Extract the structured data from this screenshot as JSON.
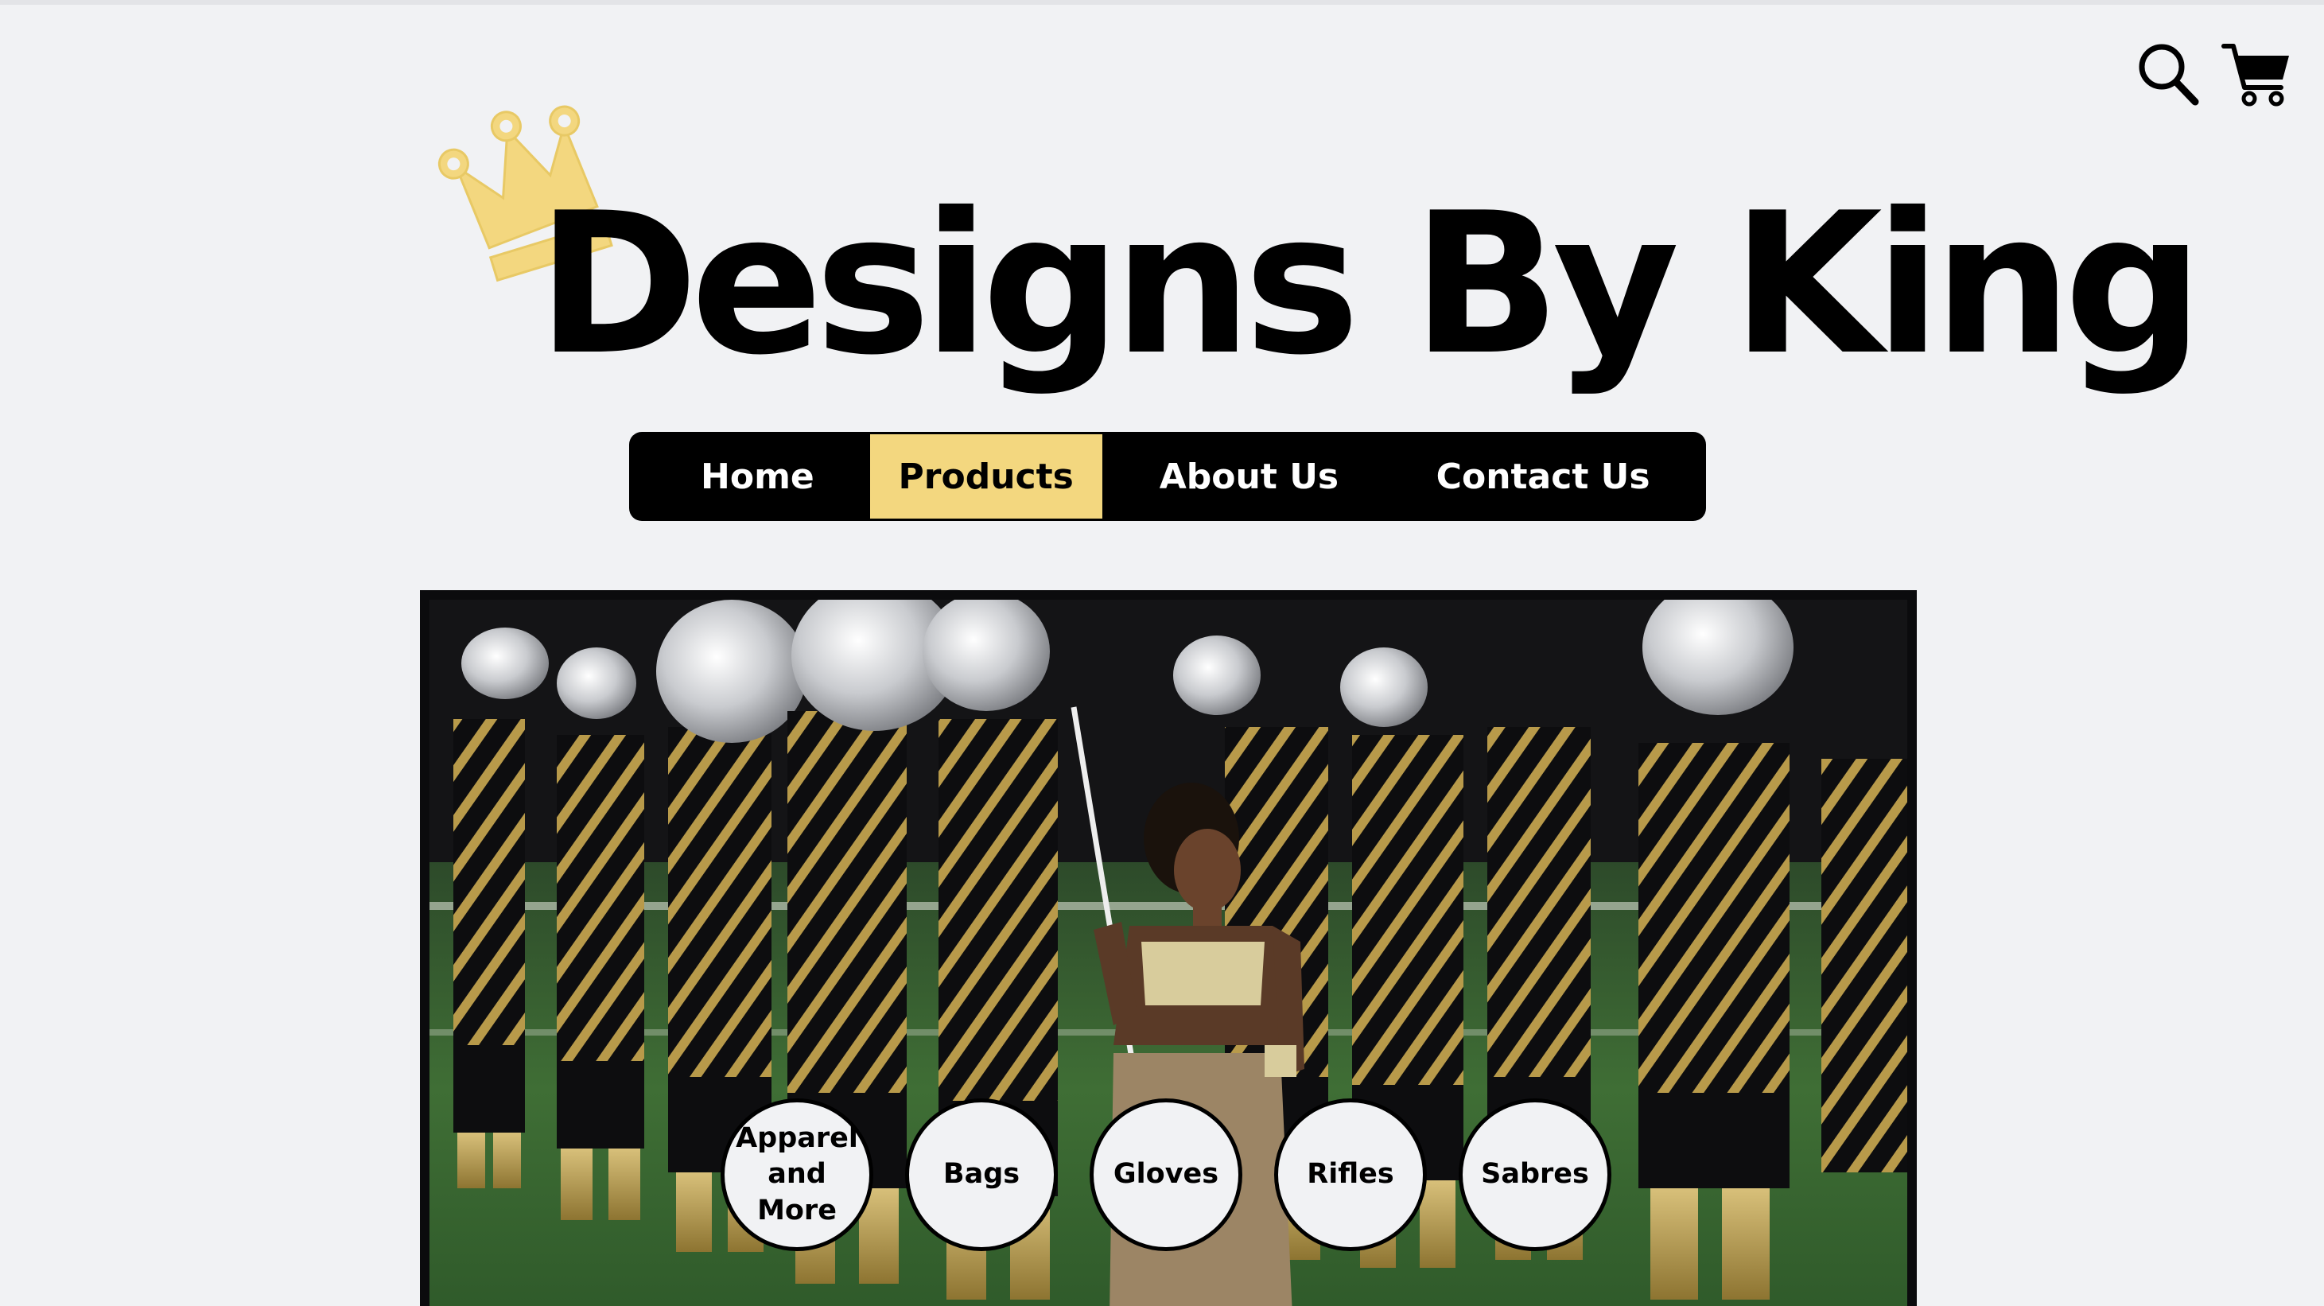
{
  "header": {
    "search_icon": "search-icon",
    "cart_icon": "cart-icon"
  },
  "brand": {
    "title": "Designs By King",
    "logo_icon": "crown-icon",
    "accent_color": "#f3d77f"
  },
  "nav": {
    "items": [
      {
        "label": "Home",
        "active": false
      },
      {
        "label": "Products",
        "active": true
      },
      {
        "label": "About Us",
        "active": false
      },
      {
        "label": "Contact Us",
        "active": false
      }
    ]
  },
  "hero": {
    "image_subject": "drum corps brass line in black and gold uniforms with color guard performer"
  },
  "categories": [
    {
      "label": "Apparel and More"
    },
    {
      "label": "Bags"
    },
    {
      "label": "Gloves"
    },
    {
      "label": "Rifles"
    },
    {
      "label": "Sabres"
    }
  ]
}
